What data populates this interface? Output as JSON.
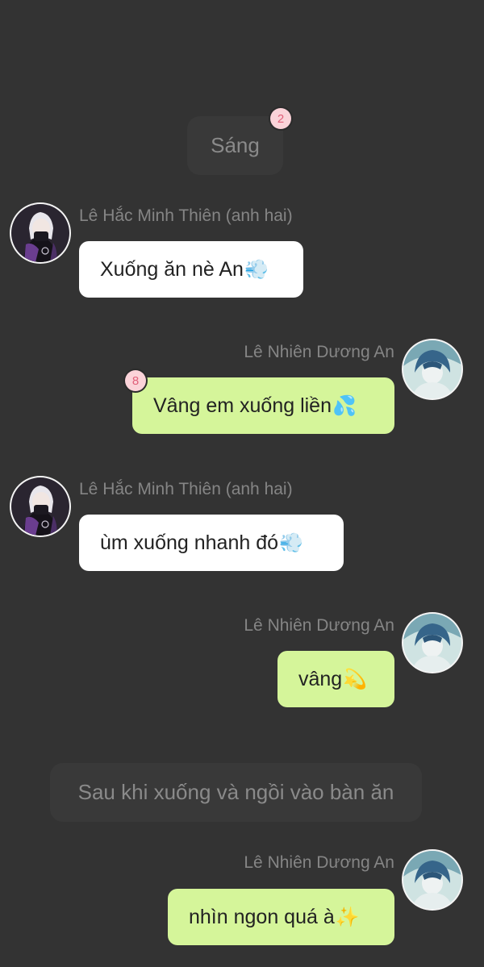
{
  "colors": {
    "background": "#333333",
    "left_bubble": "#ffffff",
    "right_bubble": "#d5f59a",
    "narration_bg": "#393939",
    "badge_bg": "#fbd3d9",
    "badge_text": "#e0607a"
  },
  "narrations": [
    {
      "text": "Sáng",
      "badge": "2"
    },
    {
      "text": "Sau khi xuống và ngồi vào bàn ăn"
    }
  ],
  "messages": [
    {
      "side": "left",
      "sender": "Lê Hắc Minh Thiên (anh hai)",
      "text": "Xuống ăn nè An",
      "emoji": "dashing-away-emoji",
      "emoji_glyph": "💨"
    },
    {
      "side": "right",
      "sender": "Lê Nhiên Dương An",
      "text": "Vâng em xuống liền",
      "emoji": "sweat-droplets-emoji",
      "emoji_glyph": "💦",
      "badge": "8"
    },
    {
      "side": "left",
      "sender": "Lê Hắc Minh Thiên (anh hai)",
      "text": "ùm xuống nhanh đó",
      "emoji": "dashing-away-emoji",
      "emoji_glyph": "💨"
    },
    {
      "side": "right",
      "sender": "Lê Nhiên Dương An",
      "text": "vâng",
      "emoji": "dizzy-emoji",
      "emoji_glyph": "💫"
    },
    {
      "side": "right",
      "sender": "Lê Nhiên Dương An",
      "text": "nhìn ngon quá à",
      "emoji": "sparkles-emoji",
      "emoji_glyph": "✨"
    }
  ]
}
